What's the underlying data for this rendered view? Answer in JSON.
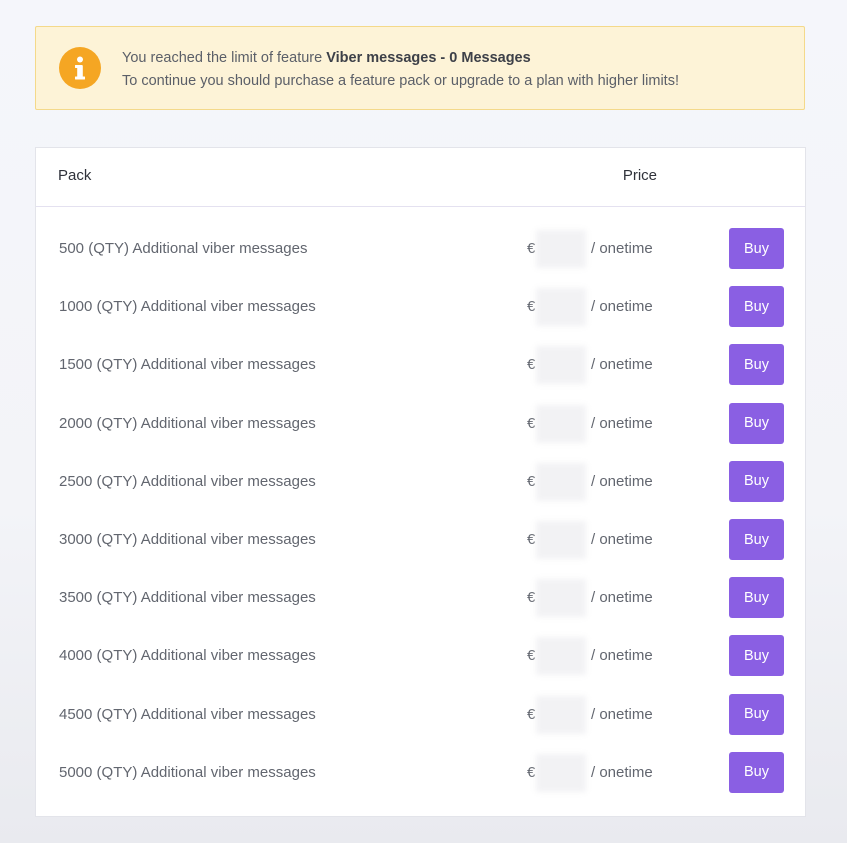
{
  "alert": {
    "line1_prefix": "You reached the limit of feature ",
    "line1_bold": "Viber messages - 0 Messages",
    "line2": "To continue you should purchase a feature pack or upgrade to a plan with higher limits!",
    "icon": "info-icon",
    "icon_color": "#f5a623",
    "background_color": "#fdf3d7"
  },
  "table": {
    "headers": {
      "pack": "Pack",
      "price": "Price"
    },
    "buy_button_color": "#8a5fe3",
    "rows": [
      {
        "pack": "500 (QTY) Additional viber messages",
        "currency": "€",
        "period": "/ onetime",
        "button": "Buy"
      },
      {
        "pack": "1000 (QTY) Additional viber messages",
        "currency": "€",
        "period": "/ onetime",
        "button": "Buy"
      },
      {
        "pack": "1500 (QTY) Additional viber messages",
        "currency": "€",
        "period": "/ onetime",
        "button": "Buy"
      },
      {
        "pack": "2000 (QTY) Additional viber messages",
        "currency": "€",
        "period": "/ onetime",
        "button": "Buy"
      },
      {
        "pack": "2500 (QTY) Additional viber messages",
        "currency": "€",
        "period": "/ onetime",
        "button": "Buy"
      },
      {
        "pack": "3000 (QTY) Additional viber messages",
        "currency": "€",
        "period": "/ onetime",
        "button": "Buy"
      },
      {
        "pack": "3500 (QTY) Additional viber messages",
        "currency": "€",
        "period": "/ onetime",
        "button": "Buy"
      },
      {
        "pack": "4000 (QTY) Additional viber messages",
        "currency": "€",
        "period": "/ onetime",
        "button": "Buy"
      },
      {
        "pack": "4500 (QTY) Additional viber messages",
        "currency": "€",
        "period": "/ onetime",
        "button": "Buy"
      },
      {
        "pack": "5000 (QTY) Additional viber messages",
        "currency": "€",
        "period": "/ onetime",
        "button": "Buy"
      }
    ]
  }
}
